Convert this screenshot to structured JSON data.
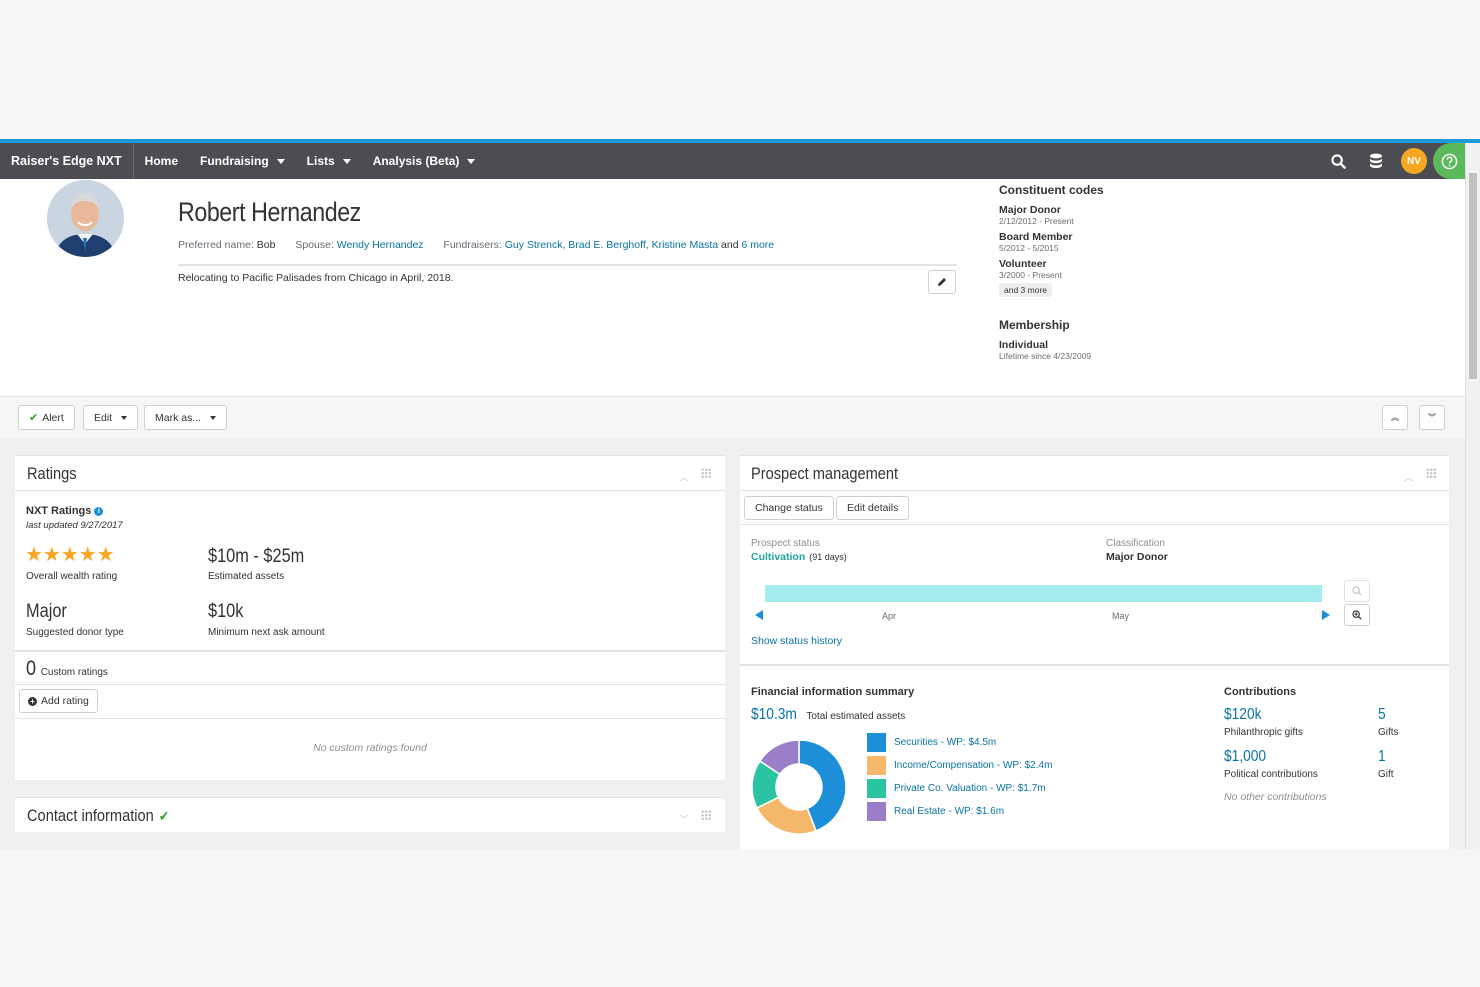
{
  "navbar": {
    "brand": "Raiser's Edge NXT",
    "items": [
      {
        "label": "Home",
        "dropdown": false
      },
      {
        "label": "Fundraising",
        "dropdown": true
      },
      {
        "label": "Lists",
        "dropdown": true
      },
      {
        "label": "Analysis (Beta)",
        "dropdown": true
      }
    ],
    "user_initials": "NV",
    "accent_color": "#1c9bd8"
  },
  "constituent": {
    "name": "Robert Hernandez",
    "preferred_label": "Preferred name:",
    "preferred_value": "Bob",
    "spouse_label": "Spouse:",
    "spouse_value": "Wendy Hernandez",
    "fundraisers_label": "Fundraisers:",
    "fundraisers_value": "Guy Strenck, Brad E. Berghoff, Kristine Masta",
    "and_text": "and",
    "more_link": "6 more",
    "note": "Relocating to Pacific Palisades from Chicago in April, 2018."
  },
  "constituent_codes": {
    "heading": "Constituent codes",
    "codes": [
      {
        "name": "Major Donor",
        "dates": "2/12/2012 - Present"
      },
      {
        "name": "Board Member",
        "dates": "5/2012 - 5/2015"
      },
      {
        "name": "Volunteer",
        "dates": "3/2000 - Present"
      }
    ],
    "more_chip": "and 3 more",
    "membership_heading": "Membership",
    "membership_name": "Individual",
    "membership_detail": "Lifetime since 4/23/2009"
  },
  "actions": {
    "alert": "Alert",
    "edit": "Edit",
    "mark_as": "Mark as..."
  },
  "ratings": {
    "title": "Ratings",
    "nxt_label": "NXT Ratings",
    "last_updated": "last updated 9/27/2017",
    "stars": "★★★★★",
    "star_count": 5,
    "overall_label": "Overall wealth rating",
    "estimated_assets_value": "$10m - $25m",
    "estimated_assets_label": "Estimated assets",
    "donor_type_value": "Major",
    "donor_type_label": "Suggested donor type",
    "min_ask_value": "$10k",
    "min_ask_label": "Minimum next ask amount",
    "custom_count": "0",
    "custom_label": "Custom ratings",
    "add_rating": "Add rating",
    "empty_message": "No custom ratings found"
  },
  "contact": {
    "title": "Contact information"
  },
  "prospect": {
    "title": "Prospect management",
    "change_status": "Change status",
    "edit_details": "Edit details",
    "status_label": "Prospect status",
    "status_value": "Cultivation",
    "status_days": "(91 days)",
    "classification_label": "Classification",
    "classification_value": "Major Donor",
    "timeline_months": [
      "Apr",
      "May"
    ],
    "show_history": "Show status history",
    "timeline_color": "#a6ecef"
  },
  "financial": {
    "heading": "Financial information summary",
    "total_value": "$10.3m",
    "total_label": "Total estimated assets",
    "chart_data": {
      "type": "pie",
      "categories": [
        "Securities - WP",
        "Income/Compensation - WP",
        "Private Co. Valuation - WP",
        "Real Estate - WP"
      ],
      "values": [
        4.5,
        2.4,
        1.7,
        1.6
      ],
      "colors": [
        "#1c8fd8",
        "#f5b76a",
        "#2bc4a2",
        "#9a7ec8"
      ]
    },
    "legend": [
      {
        "label": "Securities - WP: $4.5m",
        "color": "#1c8fd8"
      },
      {
        "label": "Income/Compensation - WP: $2.4m",
        "color": "#f5b76a"
      },
      {
        "label": "Private Co. Valuation - WP: $1.7m",
        "color": "#2bc4a2"
      },
      {
        "label": "Real Estate - WP: $1.6m",
        "color": "#9a7ec8"
      }
    ]
  },
  "contributions": {
    "heading": "Contributions",
    "philanthropic_value": "$120k",
    "philanthropic_label": "Philanthropic gifts",
    "gifts_count": "5",
    "gifts_label": "Gifts",
    "political_value": "$1,000",
    "political_label": "Political contributions",
    "political_count": "1",
    "political_count_label": "Gift",
    "other_message": "No other contributions"
  }
}
